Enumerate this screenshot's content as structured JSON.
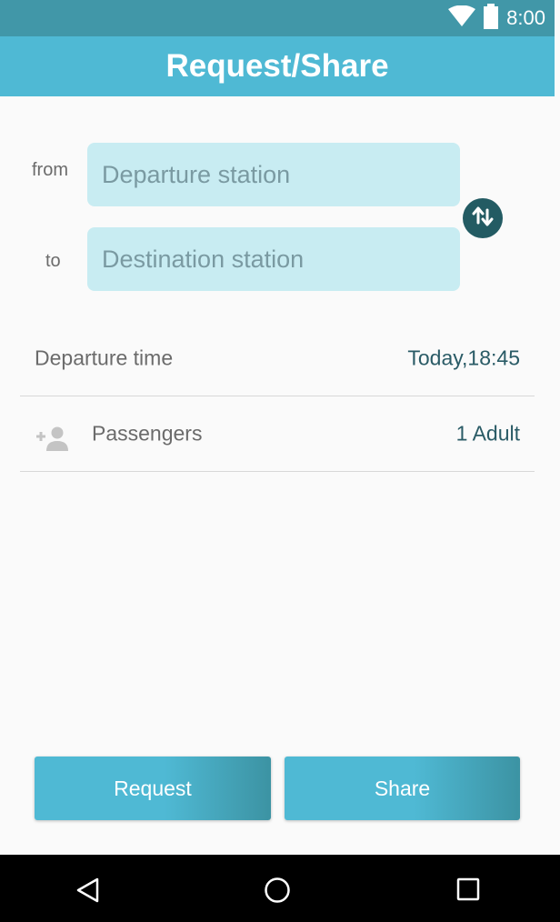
{
  "status_bar": {
    "time": "8:00",
    "wifi_icon": "wifi-icon",
    "battery_icon": "battery-icon"
  },
  "app_bar": {
    "title": "Request/Share"
  },
  "route": {
    "from_label": "from",
    "to_label": "to",
    "departure_placeholder": "Departure station",
    "destination_placeholder": "Destination station",
    "swap_icon": "swap-vertical-icon"
  },
  "departure_time": {
    "label": "Departure time",
    "value": "Today,18:45"
  },
  "passengers": {
    "icon": "add-person-icon",
    "label": "Passengers",
    "value": "1 Adult"
  },
  "actions": {
    "request_label": "Request",
    "share_label": "Share"
  },
  "nav_bar": {
    "back_icon": "back-triangle-icon",
    "home_icon": "home-circle-icon",
    "recents_icon": "recents-square-icon"
  },
  "colors": {
    "status_bar": "#4197a8",
    "app_bar": "#4fb9d4",
    "field_bg": "#c8ecf2",
    "swap_button": "#235b63",
    "value_text": "#2a5b66"
  }
}
